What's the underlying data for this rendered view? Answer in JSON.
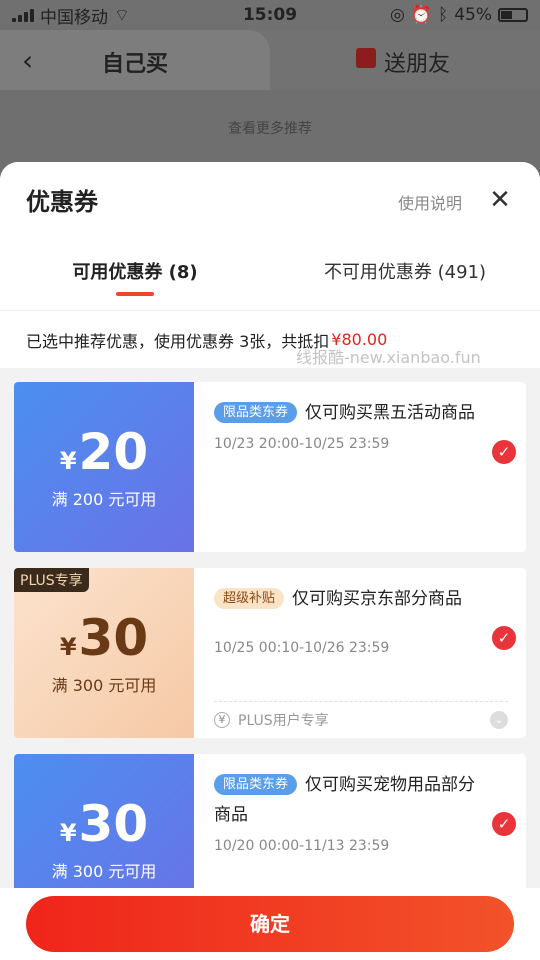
{
  "status_bar": {
    "carrier": "中国移动",
    "time": "15:09",
    "battery": "45%"
  },
  "background_header": {
    "tab_self": "自己买",
    "tab_gift": "送朋友",
    "more_recommend": "查看更多推荐"
  },
  "sheet": {
    "title": "优惠券",
    "help_label": "使用说明",
    "tabs": [
      {
        "label": "可用优惠券 (8)",
        "active": true
      },
      {
        "label": "不可用优惠券 (491)",
        "active": false
      }
    ],
    "summary_text": "已选中推荐优惠，使用优惠券 3张，共抵扣",
    "summary_amount": "¥80.00",
    "watermark": "线报酷-new.xianbao.fun"
  },
  "coupons": [
    {
      "currency": "¥",
      "amount": "20",
      "condition": "满 200 元可用",
      "tag": "限品类东券",
      "description": "仅可购买黑五活动商品",
      "date_range": "10/23 20:00-10/25 23:59",
      "selected": true,
      "style": "blue"
    },
    {
      "currency": "¥",
      "amount": "30",
      "condition": "满 300 元可用",
      "plus_badge": "PLUS专享",
      "tag": "超级补贴",
      "description": "仅可购买京东部分商品",
      "date_range": "10/25 00:10-10/26 23:59",
      "selected": true,
      "style": "peach",
      "footer_note": "PLUS用户专享"
    },
    {
      "currency": "¥",
      "amount": "30",
      "condition": "满 300 元可用",
      "tag": "限品类东券",
      "description": "仅可购买宠物用品部分商品",
      "date_range": "10/20 00:00-11/13 23:59",
      "selected": true,
      "style": "blue"
    }
  ],
  "confirm_label": "确定",
  "colors": {
    "accent": "#e1251b",
    "coupon_blue": "#4c8ff0",
    "coupon_peach": "#f5c9a6"
  }
}
